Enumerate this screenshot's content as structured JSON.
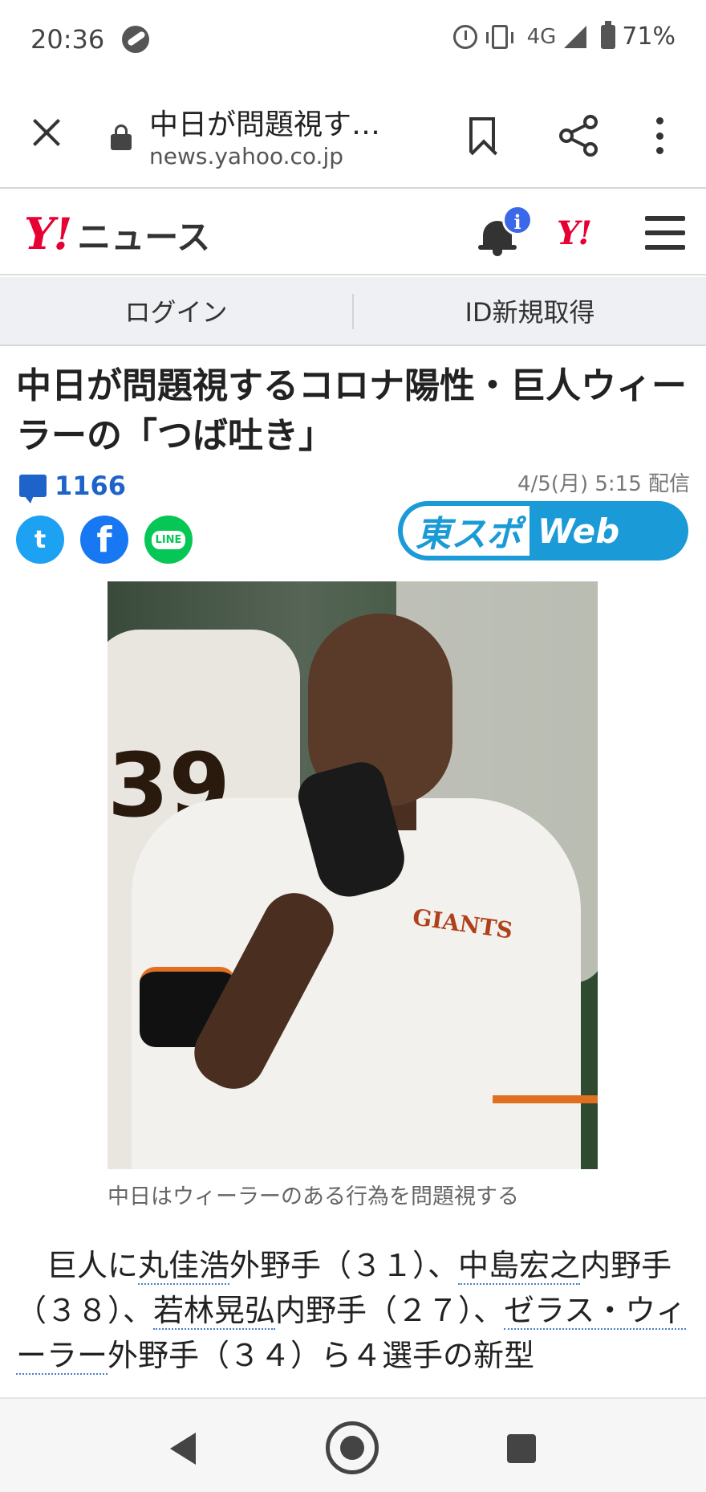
{
  "status_bar": {
    "time": "20:36",
    "network": "4G",
    "battery": "71%"
  },
  "browser": {
    "title": "中日が問題視す…",
    "url": "news.yahoo.co.jp"
  },
  "yahoo_header": {
    "logo_y": "Y!",
    "logo_news": "ニュース",
    "badge": "i",
    "mini_logo": "Y!"
  },
  "login_bar": {
    "login_label": "ログイン",
    "register_label": "ID新規取得"
  },
  "article": {
    "headline": "中日が問題視するコロナ陽性・巨人ウィーラーの「つば吐き」",
    "comment_count": "1166",
    "pubdate": "4/5(月) 5:15 配信",
    "source_logo_left": "東スポ",
    "source_logo_right": "Web",
    "photo_caption": "中日はウィーラーのある行為を問題視する",
    "photo_jersey_number": "39",
    "photo_shirt_logo": "GIANTS",
    "body": {
      "p1": "　巨人に",
      "link1": "丸佳浩",
      "p2": "外野手（３１）、",
      "link2": "中島宏之",
      "p3": "内野手（３８）、",
      "link3": "若林晃弘",
      "p4": "内野手（２７）、",
      "link4": "ゼラス・ウィーラー",
      "p5": "外野手（３４）ら４選手の新型"
    }
  },
  "share": {
    "twitter": "t",
    "facebook": "f",
    "line": "LINE"
  },
  "colors": {
    "yahoo_red": "#e60033",
    "link_blue": "#1e63c9",
    "tospo_blue": "#1a9ad6"
  }
}
